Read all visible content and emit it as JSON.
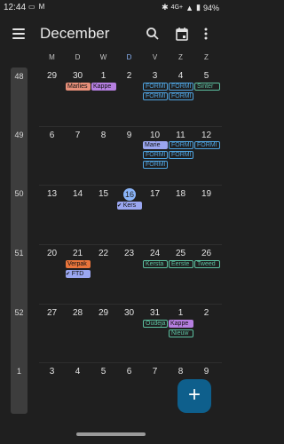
{
  "status_bar": {
    "time": "12:44",
    "left_icons": [
      "cast-icon",
      "gmail-icon"
    ],
    "network": "4G+",
    "battery": "94%"
  },
  "app_bar": {
    "title": "December",
    "icons": [
      "menu-icon",
      "search-icon",
      "calendar-today-icon",
      "more-vert-icon"
    ]
  },
  "weekdays": [
    "M",
    "D",
    "W",
    "D",
    "V",
    "Z",
    "Z"
  ],
  "weeks": [
    {
      "number": "48",
      "dates": [
        "29",
        "30",
        "1",
        "2",
        "3",
        "4",
        "5"
      ]
    },
    {
      "number": "49",
      "dates": [
        "6",
        "7",
        "8",
        "9",
        "10",
        "11",
        "12"
      ]
    },
    {
      "number": "50",
      "dates": [
        "13",
        "14",
        "15",
        "16",
        "17",
        "18",
        "19"
      ]
    },
    {
      "number": "51",
      "dates": [
        "20",
        "21",
        "22",
        "23",
        "24",
        "25",
        "26"
      ]
    },
    {
      "number": "52",
      "dates": [
        "27",
        "28",
        "29",
        "30",
        "31",
        "1",
        "2"
      ]
    },
    {
      "number": "1",
      "dates": [
        "3",
        "4",
        "5",
        "6",
        "7",
        "8",
        "9"
      ]
    }
  ],
  "events": {
    "w48": [
      "Marlies",
      "Kappe",
      "FORMI",
      "FORMI",
      "Sinter",
      "FORMI",
      "FORMI"
    ],
    "w49": [
      "Marie",
      "FORMI",
      "FORMI",
      "FORMI",
      "FORMI",
      "FORMI",
      "FORMI"
    ],
    "w50": [
      "Kers"
    ],
    "w51": [
      "Verpak",
      "FTD",
      "Kersta",
      "Eerste",
      "Tweed"
    ],
    "w52": [
      "Oudeja",
      "Kappe",
      "Nieuw"
    ]
  },
  "colors": {
    "accent": "#8ab4f8",
    "fab": "#0e5f8c",
    "blue": "#4fa3e0",
    "purple": "#b57fe0",
    "salmon": "#e8907a",
    "green": "#5cc0a0",
    "orange": "#e8743b",
    "lavender": "#9aa6f0"
  },
  "fab": {
    "label": "+"
  }
}
